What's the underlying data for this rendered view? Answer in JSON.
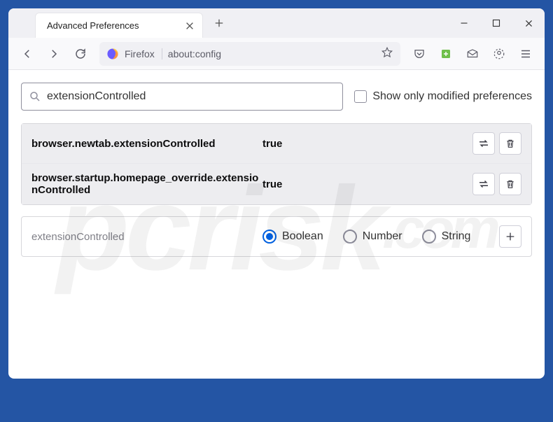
{
  "window": {
    "tab_title": "Advanced Preferences"
  },
  "addressbar": {
    "identity_label": "Firefox",
    "url": "about:config"
  },
  "search": {
    "value": "extensionControlled",
    "checkbox_label": "Show only modified preferences"
  },
  "prefs": [
    {
      "name": "browser.newtab.extensionControlled",
      "value": "true"
    },
    {
      "name": "browser.startup.homepage_override.extensionControlled",
      "value": "true"
    }
  ],
  "new_pref": {
    "name": "extensionControlled",
    "types": [
      "Boolean",
      "Number",
      "String"
    ],
    "selected": "Boolean"
  },
  "watermark": {
    "text": "pcrisk",
    "tld": ".com"
  }
}
